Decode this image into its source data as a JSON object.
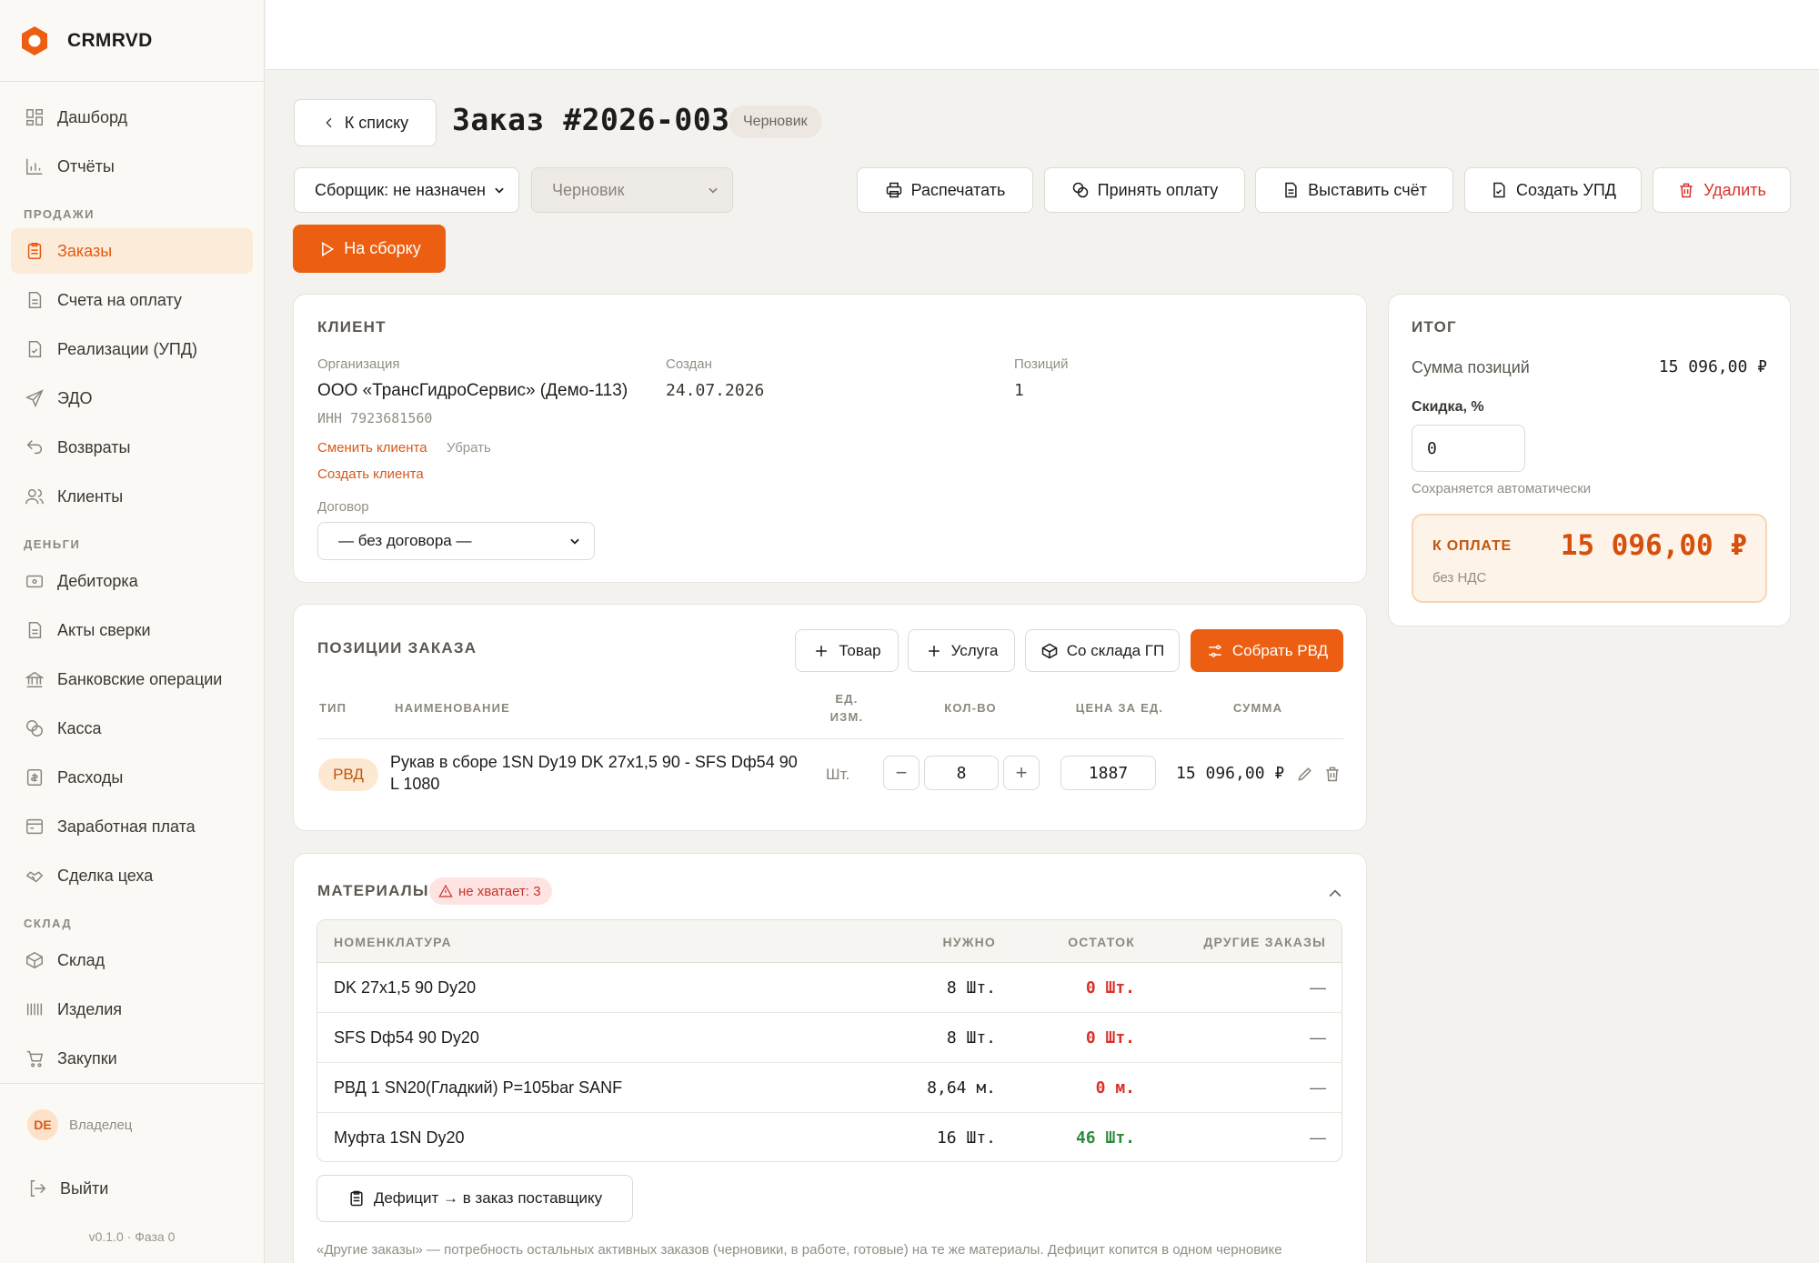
{
  "app": {
    "name": "CRMRVD",
    "version": "v0.1.0 · Фаза 0"
  },
  "sidebar": {
    "items_top": [
      {
        "label": "Дашборд",
        "icon": "dashboard-icon"
      },
      {
        "label": "Отчёты",
        "icon": "chart-icon"
      }
    ],
    "sections": [
      {
        "title": "ПРОДАЖИ",
        "items": [
          "Заказы",
          "Счета на оплату",
          "Реализации (УПД)",
          "ЭДО",
          "Возвраты",
          "Клиенты"
        ]
      },
      {
        "title": "ДЕНЬГИ",
        "items": [
          "Дебиторка",
          "Акты сверки",
          "Банковские операции",
          "Касса",
          "Расходы",
          "Заработная плата",
          "Сделка цеха"
        ]
      },
      {
        "title": "СКЛАД",
        "items": [
          "Склад",
          "Изделия",
          "Закупки"
        ]
      }
    ],
    "active": "Заказы",
    "user": {
      "initials": "DE",
      "role": "Владелец"
    },
    "logout": "Выйти"
  },
  "header": {
    "back": "К списку",
    "title": "Заказ #2026-0030",
    "status_badge": "Черновик",
    "assembler_select": "Сборщик: не назначен",
    "status_select": "Черновик",
    "actions": {
      "print": "Распечатать",
      "accept_payment": "Принять оплату",
      "invoice": "Выставить счёт",
      "upd": "Создать УПД",
      "delete": "Удалить"
    },
    "to_assembly": "На сборку"
  },
  "client": {
    "title": "КЛИЕНТ",
    "org_label": "Организация",
    "org": "ООО «ТрансГидроСервис» (Демо-113)",
    "inn": "ИНН 7923681560",
    "created_label": "Создан",
    "created": "24.07.2026",
    "positions_label": "Позиций",
    "positions": "1",
    "change": "Сменить клиента",
    "remove": "Убрать",
    "create": "Создать клиента",
    "contract_label": "Договор",
    "contract": "— без договора —"
  },
  "positions": {
    "title": "ПОЗИЦИИ ЗАКАЗА",
    "buttons": {
      "product": "Товар",
      "service": "Услуга",
      "from_stock": "Со склада ГП",
      "build_rvd": "Собрать РВД"
    },
    "columns": {
      "type": "ТИП",
      "name": "НАИМЕНОВАНИЕ",
      "unit_1": "ЕД.",
      "unit_2": "ИЗМ.",
      "qty": "КОЛ-ВО",
      "price": "ЦЕНА ЗА ЕД.",
      "sum": "СУММА"
    },
    "rows": [
      {
        "type": "РВД",
        "name_1": "Рукав в сборе 1SN Dy19 DK 27x1,5 90 - SFS Dф54 90",
        "name_2": "L 1080",
        "unit": "Шт.",
        "qty": "8",
        "price": "1887",
        "sum": "15 096,00 ₽"
      }
    ]
  },
  "materials": {
    "title": "МАТЕРИАЛЫ",
    "shortage": "не хватает: 3",
    "columns": {
      "name": "НОМЕНКЛАТУРА",
      "need": "НУЖНО",
      "stock": "ОСТАТОК",
      "other": "ДРУГИЕ ЗАКАЗЫ"
    },
    "rows": [
      {
        "name": "DK 27x1,5 90 Dy20",
        "need": "8 Шт.",
        "stock": "0 Шт.",
        "other": "—",
        "status": "red"
      },
      {
        "name": "SFS Dф54 90 Dy20",
        "need": "8 Шт.",
        "stock": "0 Шт.",
        "other": "—",
        "status": "red"
      },
      {
        "name": "РВД 1 SN20(Гладкий) P=105bar SANF",
        "need": "8,64 м.",
        "stock": "0 м.",
        "other": "—",
        "status": "red"
      },
      {
        "name": "Муфта 1SN Dy20",
        "need": "16 Шт.",
        "stock": "46 Шт.",
        "other": "—",
        "status": "green"
      }
    ],
    "deficit_button": "Дефицит → в заказ поставщику",
    "footnote": "«Другие заказы» — потребность остальных активных заказов (черновики, в работе, готовые) на те же материалы. Дефицит копится в одном черновике"
  },
  "totals": {
    "title": "ИТОГ",
    "sum_label": "Сумма позиций",
    "sum": "15 096,00 ₽",
    "discount_label": "Скидка, %",
    "discount": "0",
    "autosave": "Сохраняется автоматически",
    "to_pay_label": "К ОПЛАТЕ",
    "to_pay": "15 096,00 ₽",
    "vat": "без НДС"
  },
  "colors": {
    "accent": "#ec5f12",
    "danger": "#d8332b",
    "ok": "#2e8b3c"
  }
}
